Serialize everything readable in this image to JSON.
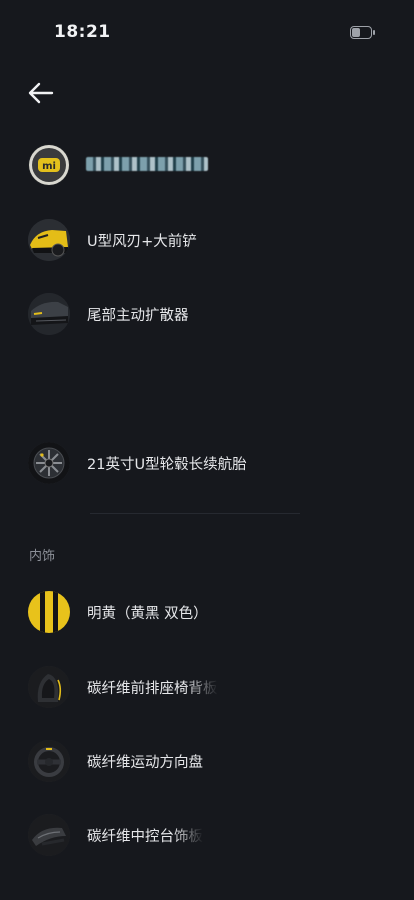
{
  "status_bar": {
    "time": "18:21",
    "battery_level": 0.45
  },
  "header": {
    "back_icon": "arrow-left-icon"
  },
  "exterior_items": [
    {
      "label": "",
      "thumbnail": "mi-badge"
    },
    {
      "label": "U型风刃+大前铲",
      "thumbnail": "front-bumper-yellow"
    },
    {
      "label": "尾部主动扩散器",
      "thumbnail": "rear-diffuser"
    },
    {
      "label": "21英寸U型轮毂长续航胎",
      "thumbnail": "wheel"
    }
  ],
  "interior_section": {
    "title": "内饰",
    "items": [
      {
        "label": "明黄（黄黑 双色）",
        "thumbnail": "yellow-black-swatch"
      },
      {
        "label": "碳纤维前排座椅背板",
        "thumbnail": "carbon-seat-back"
      },
      {
        "label": "碳纤维运动方向盘",
        "thumbnail": "carbon-steering-wheel"
      },
      {
        "label": "碳纤维中控台饰板",
        "thumbnail": "carbon-center-console"
      }
    ]
  },
  "colors": {
    "background": "#16181d",
    "accent_yellow": "#e8c21b"
  }
}
